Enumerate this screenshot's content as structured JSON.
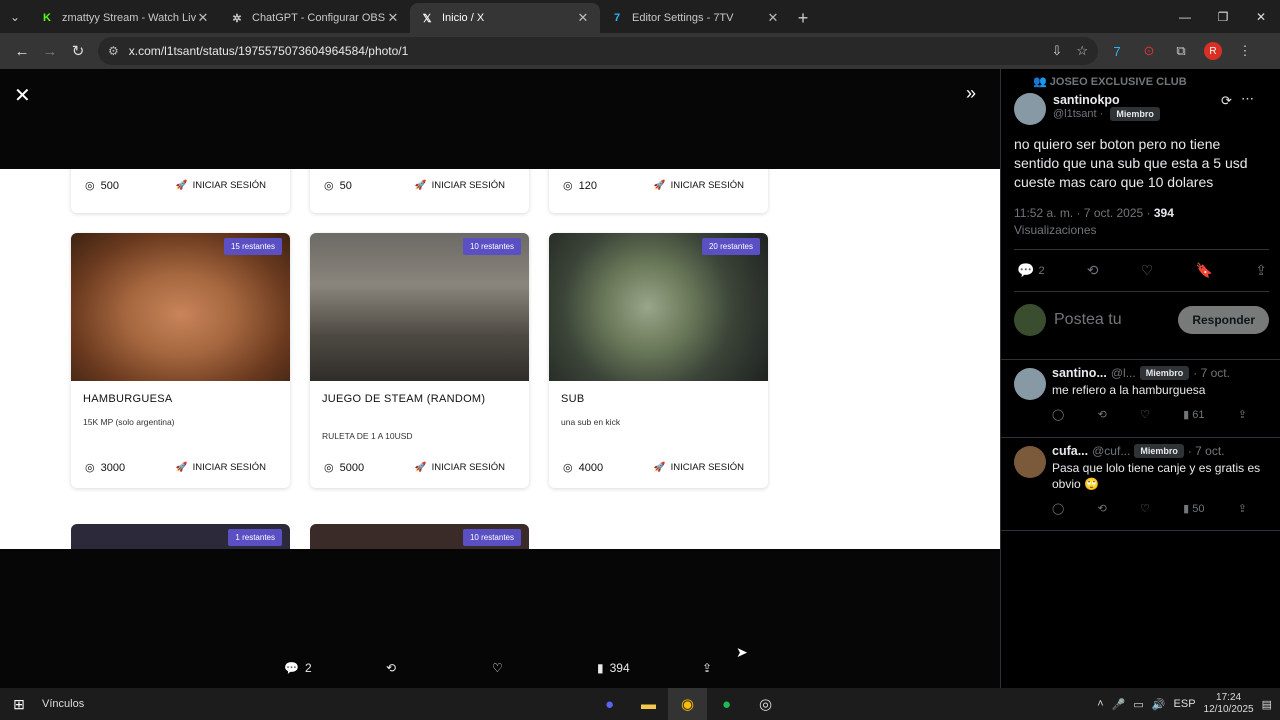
{
  "tabs": [
    {
      "title": "zmattyy Stream - Watch Live on",
      "icon": "kick-icon",
      "color": "#53fc18",
      "glyph": "K",
      "active": false
    },
    {
      "title": "ChatGPT - Configurar OBS para",
      "icon": "openai-icon",
      "color": "#ffffff",
      "glyph": "✲",
      "active": false
    },
    {
      "title": "Inicio / X",
      "icon": "x-logo-icon",
      "color": "#ffffff",
      "glyph": "𝕏",
      "active": true
    },
    {
      "title": "Editor Settings - 7TV",
      "icon": "7tv-icon",
      "color": "#29b6f6",
      "glyph": "7",
      "active": false
    }
  ],
  "address": {
    "url": "x.com/l1tsant/status/1975575073604964584/photo/1"
  },
  "profile_initial": "R",
  "cards_top_row": [
    {
      "points": "500",
      "login": "INICIAR SESIÓN"
    },
    {
      "points": "50",
      "login": "INICIAR SESIÓN"
    },
    {
      "points": "120",
      "login": "INICIAR SESIÓN"
    }
  ],
  "cards": [
    {
      "badge": "15 restantes",
      "title": "HAMBURGUESA",
      "desc": "15K MP (solo argentina)",
      "points": "3000",
      "login": "INICIAR SESIÓN",
      "image": "burger-face-image"
    },
    {
      "badge": "10 restantes",
      "title": "JUEGO DE STEAM (RANDOM)",
      "desc": "RULETA DE 1 A 10USD",
      "points": "5000",
      "login": "INICIAR SESIÓN",
      "image": "street-photo-image"
    },
    {
      "badge": "20 restantes",
      "title": "SUB",
      "desc": "una sub en kick",
      "points": "4000",
      "login": "INICIAR SESIÓN",
      "image": "money-washer-image"
    }
  ],
  "stubs": [
    {
      "badge": "1 restantes"
    },
    {
      "badge": "10 restantes"
    }
  ],
  "bottom_bar": {
    "replies": "2",
    "views": "394"
  },
  "post": {
    "community": "JOSEO EXCLUSIVE CLUB",
    "author_name": "santinokpo",
    "author_handle": "@l1tsant",
    "member_badge": "Miembro",
    "text": "no quiero ser boton pero no tiene sentido que una sub que esta a 5 usd cueste mas caro que 10 dolares",
    "time": "11:52 a. m. · 7 oct. 2025 ·",
    "views_count": "394",
    "views_label": "Visualizaciones",
    "replies": "2",
    "reply_placeholder": "Postea tu",
    "reply_button": "Responder"
  },
  "comments": [
    {
      "name": "santino...",
      "handle": "@l...",
      "badge": "Miembro",
      "date": "· 7 oct.",
      "text": "me refiero a la hamburguesa",
      "views": "61"
    },
    {
      "name": "cufa...",
      "handle": "@cuf...",
      "badge": "Miembro",
      "date": "· 7 oct.",
      "text": "Pasa que lolo tiene canje y es gratis es obvio 🙄",
      "views": "50"
    }
  ],
  "taskbar": {
    "label": "Vínculos",
    "lang": "ESP",
    "time": "17:24",
    "date": "12/10/2025"
  }
}
